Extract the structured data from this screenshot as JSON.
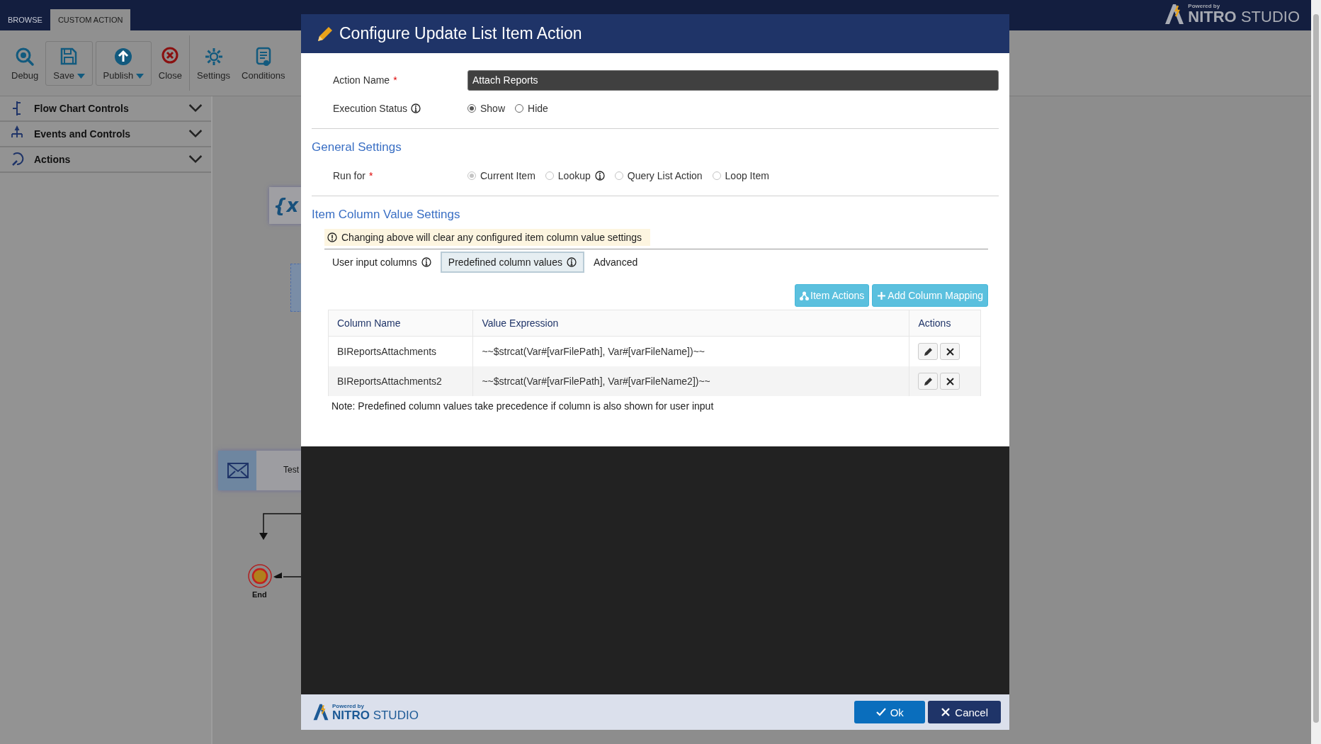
{
  "app_bar": {
    "tabs": [
      {
        "label": "BROWSE",
        "selected": false
      },
      {
        "label": "CUSTOM ACTION",
        "selected": true
      }
    ],
    "brand": {
      "tagline": "Powered by",
      "name": "NITRO",
      "suffix": "STUDIO"
    }
  },
  "ribbon": [
    {
      "label": "Debug",
      "dropdown": false
    },
    {
      "label": "Save",
      "dropdown": true
    },
    {
      "label": "Publish",
      "dropdown": true
    },
    {
      "label": "Close",
      "dropdown": false
    },
    {
      "label": "Settings",
      "dropdown": false
    },
    {
      "label": "Conditions",
      "dropdown": false
    }
  ],
  "sidebar": {
    "sections": [
      {
        "label": "Flow Chart Controls",
        "expanded": false
      },
      {
        "label": "Events and Controls",
        "expanded": false
      },
      {
        "label": "Actions",
        "expanded": false
      }
    ]
  },
  "canvas": {
    "nodes": [
      {
        "kind": "variable",
        "label": "{x"
      },
      {
        "kind": "selected"
      },
      {
        "kind": "email",
        "label": "Test"
      },
      {
        "kind": "end",
        "label": "End"
      }
    ]
  },
  "dialog": {
    "title": "Configure Update List Item Action",
    "action_name": {
      "label": "Action Name",
      "required_mark": "*",
      "value": "Attach Reports"
    },
    "execution_status": {
      "label": "Execution Status",
      "options": [
        {
          "label": "Show",
          "selected": true
        },
        {
          "label": "Hide",
          "selected": false
        }
      ]
    },
    "general_settings": {
      "heading": "General Settings",
      "run_for": {
        "label": "Run for",
        "required_mark": "*",
        "options": [
          {
            "label": "Current Item",
            "selected": true,
            "disabled": true
          },
          {
            "label": "Lookup",
            "selected": false,
            "disabled": true,
            "info": true
          },
          {
            "label": "Query List Action",
            "selected": false,
            "disabled": true
          },
          {
            "label": "Loop Item",
            "selected": false,
            "disabled": true
          }
        ]
      }
    },
    "item_column_settings": {
      "heading": "Item Column Value Settings",
      "warning": "Changing above will clear any configured item column value settings",
      "tabs": [
        {
          "label": "User input columns",
          "selected": false,
          "info": true
        },
        {
          "label": "Predefined column values",
          "selected": true,
          "info": true
        },
        {
          "label": "Advanced",
          "selected": false,
          "info": false
        }
      ],
      "buttons": [
        {
          "kind": "item-actions",
          "label": "Item Actions"
        },
        {
          "kind": "add",
          "label": "Add Column Mapping"
        }
      ],
      "table": {
        "columns": [
          "Column Name",
          "Value Expression",
          "Actions"
        ],
        "rows": [
          {
            "column_name": "BIReportsAttachments",
            "value_expression": "~~$strcat(Var#[varFilePath], Var#[varFileName])~~"
          },
          {
            "column_name": "BIReportsAttachments2",
            "value_expression": "~~$strcat(Var#[varFilePath], Var#[varFileName2])~~"
          }
        ]
      },
      "note": "Note: Predefined column values take precedence if column is also shown for user input"
    },
    "footer": {
      "brand": {
        "tagline": "Powered by",
        "name": "NITRO",
        "suffix": "STUDIO"
      },
      "buttons": [
        {
          "kind": "ok",
          "label": "Ok"
        },
        {
          "kind": "cancel",
          "label": "Cancel"
        }
      ]
    }
  }
}
